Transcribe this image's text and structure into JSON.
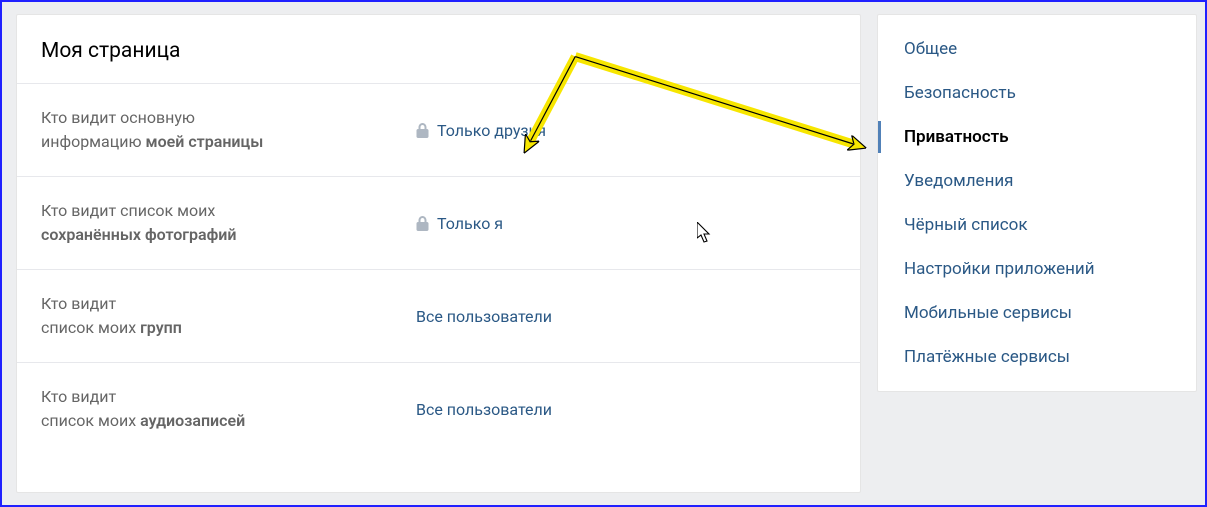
{
  "section": {
    "title": "Моя страница"
  },
  "settings": [
    {
      "label_line1": "Кто видит основную",
      "label_line2_pre": "информацию ",
      "label_line2_bold": "моей страницы",
      "value": "Только друзья",
      "locked": true
    },
    {
      "label_line1": "Кто видит список моих",
      "label_line2_pre": "",
      "label_line2_bold": "сохранённых фотографий",
      "value": "Только я",
      "locked": true
    },
    {
      "label_line1": "Кто видит",
      "label_line2_pre": "список моих ",
      "label_line2_bold": "групп",
      "value": "Все пользователи",
      "locked": false
    },
    {
      "label_line1": "Кто видит",
      "label_line2_pre": "список моих ",
      "label_line2_bold": "аудиозаписей",
      "value": "Все пользователи",
      "locked": false
    }
  ],
  "sidebar": {
    "items": [
      {
        "label": "Общее",
        "active": false
      },
      {
        "label": "Безопасность",
        "active": false
      },
      {
        "label": "Приватность",
        "active": true
      },
      {
        "label": "Уведомления",
        "active": false
      },
      {
        "label": "Чёрный список",
        "active": false
      },
      {
        "label": "Настройки приложений",
        "active": false
      },
      {
        "label": "Мобильные сервисы",
        "active": false
      },
      {
        "label": "Платёжные сервисы",
        "active": false
      }
    ]
  },
  "annotation": {
    "arrows": [
      {
        "from": "center-top",
        "to": "setting-0-value"
      },
      {
        "from": "center-top",
        "to": "sidebar-privacy"
      }
    ]
  }
}
